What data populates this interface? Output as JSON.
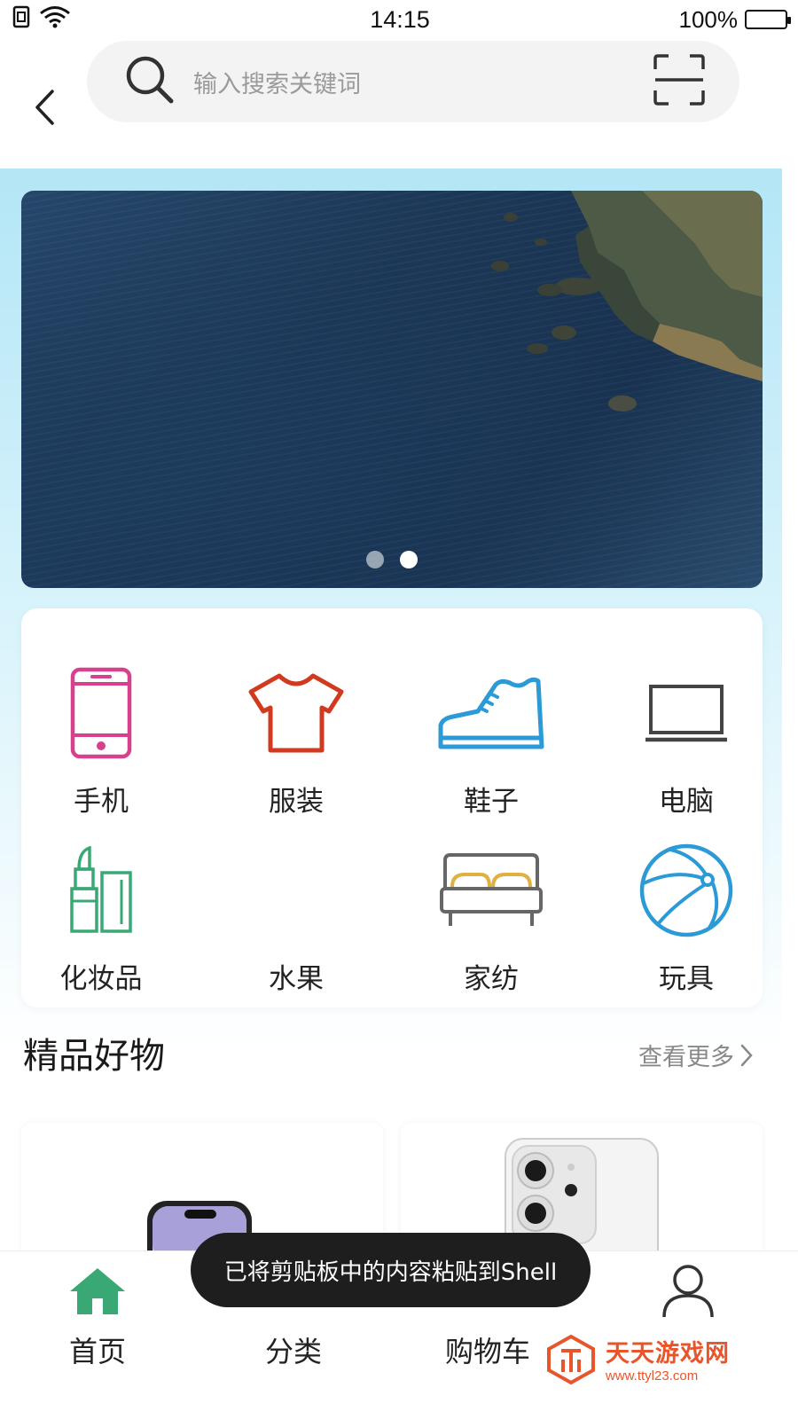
{
  "status_bar": {
    "time": "14:15",
    "battery": "100%"
  },
  "search": {
    "placeholder": "输入搜索关键词"
  },
  "banner": {
    "page_count": 2,
    "active_index": 1
  },
  "categories": [
    {
      "label": "手机",
      "icon": "phone-icon",
      "color": "#d6408c"
    },
    {
      "label": "服装",
      "icon": "tshirt-icon",
      "color": "#d23a1f"
    },
    {
      "label": "鞋子",
      "icon": "shoe-icon",
      "color": "#2b9ad6"
    },
    {
      "label": "电脑",
      "icon": "laptop-icon",
      "color": "#444444"
    },
    {
      "label": "化妆品",
      "icon": "cosmetics-icon",
      "color": "#3aa874"
    },
    {
      "label": "水果",
      "icon": "fruit-icon",
      "color": ""
    },
    {
      "label": "家纺",
      "icon": "bed-icon",
      "color": "#e0b040"
    },
    {
      "label": "玩具",
      "icon": "ball-icon",
      "color": "#2b9ad6"
    }
  ],
  "section": {
    "title": "精品好物",
    "see_more": "查看更多"
  },
  "bottom_nav": [
    {
      "label": "首页",
      "icon": "home-icon",
      "active": true,
      "color": "#3aa874"
    },
    {
      "label": "分类",
      "icon": "category-icon",
      "active": false
    },
    {
      "label": "购物车",
      "icon": "cart-icon",
      "active": false
    },
    {
      "label": "",
      "icon": "user-icon",
      "active": false
    }
  ],
  "toast": {
    "message": "已将剪贴板中的内容粘贴到Shell"
  },
  "watermark": {
    "title": "天天游戏网",
    "url": "www.ttyl23.com"
  }
}
